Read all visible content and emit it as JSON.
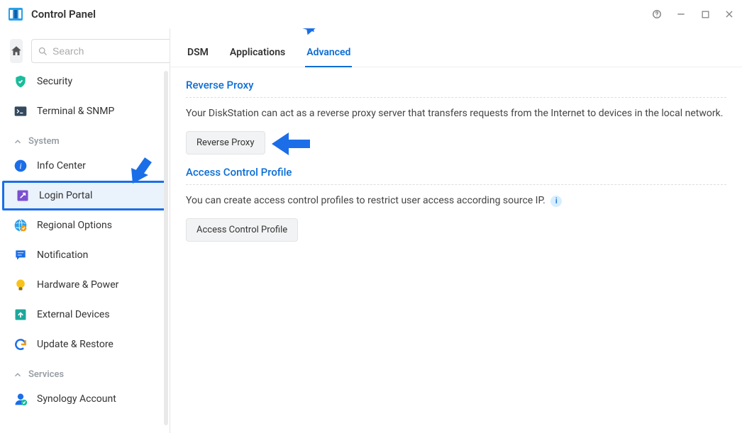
{
  "window": {
    "title": "Control Panel"
  },
  "search": {
    "placeholder": "Search"
  },
  "sidebar": {
    "security": "Security",
    "terminal": "Terminal & SNMP",
    "group_system": "System",
    "info_center": "Info Center",
    "login_portal": "Login Portal",
    "regional": "Regional Options",
    "notification": "Notification",
    "hardware": "Hardware & Power",
    "external": "External Devices",
    "update": "Update & Restore",
    "group_services": "Services",
    "synology_account": "Synology Account"
  },
  "tabs": {
    "dsm": "DSM",
    "applications": "Applications",
    "advanced": "Advanced"
  },
  "sections": {
    "reverse_proxy": {
      "title": "Reverse Proxy",
      "desc": "Your DiskStation can act as a reverse proxy server that transfers requests from the Internet to devices in the local network.",
      "button": "Reverse Proxy"
    },
    "access_control": {
      "title": "Access Control Profile",
      "desc": "You can create access control profiles to restrict user access according source IP.",
      "button": "Access Control Profile"
    }
  }
}
